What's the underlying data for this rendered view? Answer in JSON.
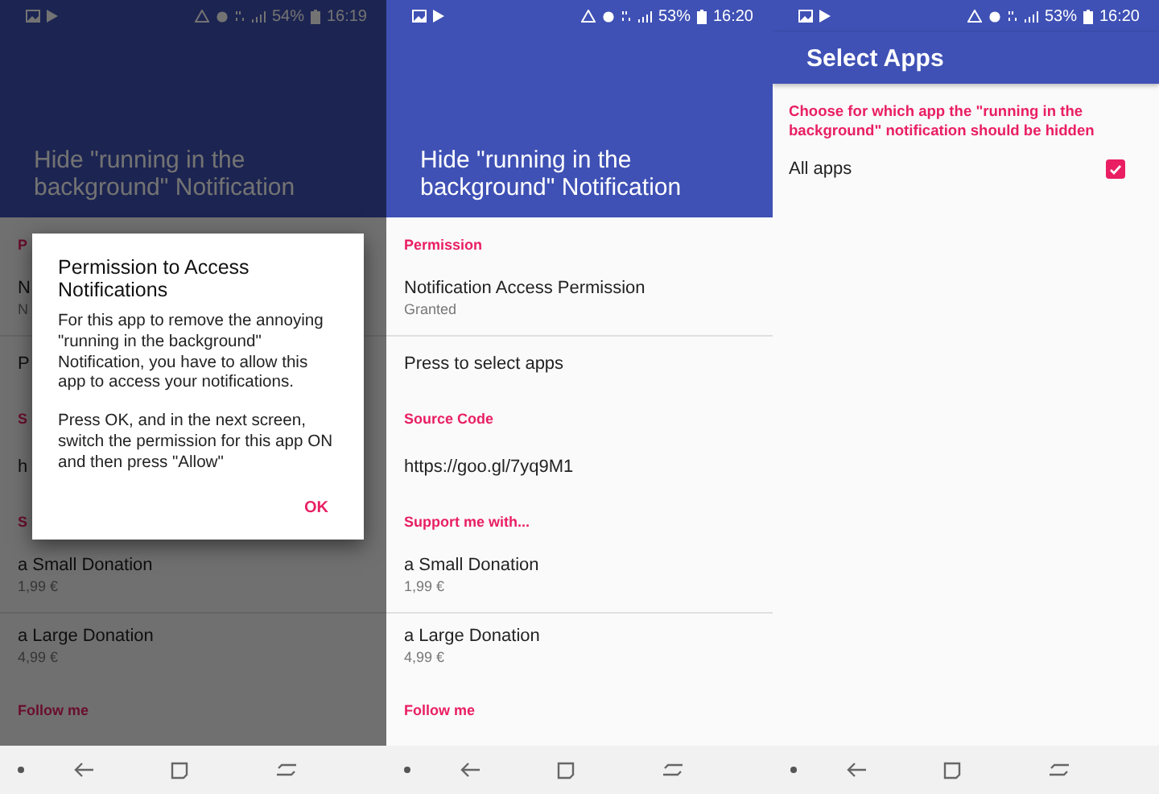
{
  "screens": [
    {
      "kind": "settings",
      "status_bar": {
        "battery": "54%",
        "time": "16:19"
      },
      "header": {
        "title": "Hide \"running in the background\" Notification"
      },
      "list": [
        {
          "kind": "section",
          "title": "P"
        },
        {
          "kind": "item",
          "title": "N",
          "summary": "N",
          "divider": true
        },
        {
          "kind": "item",
          "title": "P",
          "divider": false
        },
        {
          "kind": "section",
          "title": "S"
        },
        {
          "kind": "item",
          "title": "h",
          "divider": false
        },
        {
          "kind": "section",
          "title": "S"
        },
        {
          "kind": "item",
          "title": "a Small Donation",
          "summary": "1,99 €",
          "divider": true
        },
        {
          "kind": "item",
          "title": "a Large Donation",
          "summary": "4,99 €",
          "divider": false
        },
        {
          "kind": "section",
          "title": "Follow me"
        }
      ],
      "dialog": {
        "title": "Permission to Access Notifications",
        "paragraphs": [
          "For this app to remove the annoying \"running in the background\" Notification, you have to allow this app to access your notifications.",
          "Press OK, and in the next screen, switch the permission for this app ON and then press \"Allow\""
        ],
        "button": "OK"
      }
    },
    {
      "kind": "settings",
      "status_bar": {
        "battery": "53%",
        "time": "16:20"
      },
      "header": {
        "title": "Hide \"running in the background\" Notification"
      },
      "list": [
        {
          "kind": "section",
          "title": "Permission"
        },
        {
          "kind": "item",
          "title": "Notification Access Permission",
          "summary": "Granted",
          "divider": true
        },
        {
          "kind": "item",
          "title": "Press to select apps",
          "divider": false
        },
        {
          "kind": "section",
          "title": "Source Code"
        },
        {
          "kind": "item",
          "title": "https://goo.gl/7yq9M1",
          "divider": false
        },
        {
          "kind": "section",
          "title": "Support me with..."
        },
        {
          "kind": "item",
          "title": "a Small Donation",
          "summary": "1,99 €",
          "divider": true
        },
        {
          "kind": "item",
          "title": "a Large Donation",
          "summary": "4,99 €",
          "divider": false
        },
        {
          "kind": "section",
          "title": "Follow me"
        }
      ]
    },
    {
      "kind": "select",
      "status_bar": {
        "battery": "53%",
        "time": "16:20"
      },
      "toolbar": {
        "title": "Select Apps"
      },
      "note": "Choose for which app the \"running in the background\" notification should be hidden",
      "options": [
        {
          "label": "All apps",
          "checked": true
        }
      ]
    }
  ]
}
